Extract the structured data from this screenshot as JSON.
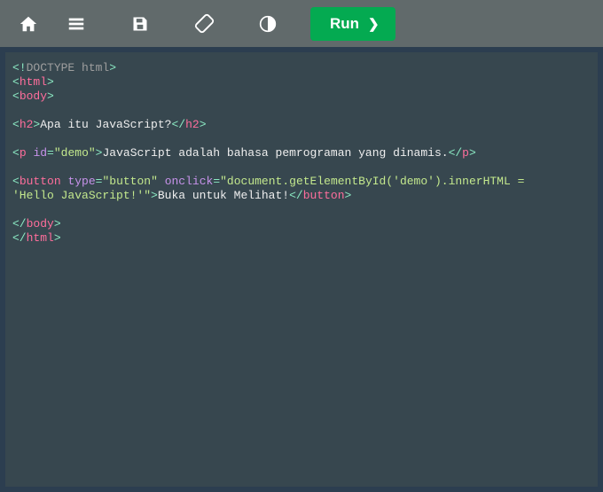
{
  "toolbar": {
    "run_label": "Run"
  },
  "code": {
    "doctype": "DOCTYPE html",
    "html_tag": "html",
    "body_tag": "body",
    "h2_tag": "h2",
    "h2_text": "Apa itu JavaScript?",
    "p_tag": "p",
    "p_attr_id": "id",
    "p_attr_id_val": "\"demo\"",
    "p_text": "JavaScript adalah bahasa pemrograman yang dinamis.",
    "button_tag": "button",
    "button_attr_type": "type",
    "button_attr_type_val": "\"button\"",
    "button_attr_onclick": "onclick",
    "button_attr_onclick_val1": "\"document.getElementById('demo').innerHTML = ",
    "button_attr_onclick_val2": "'Hello JavaScript!'\"",
    "button_text": "Buka untuk Melihat!"
  }
}
